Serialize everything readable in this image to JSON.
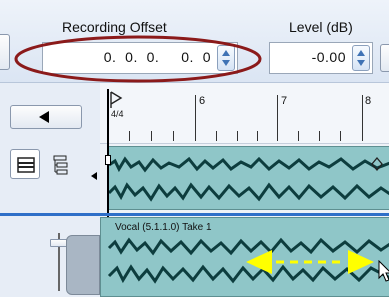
{
  "toolbar": {
    "recording_offset_label": "Recording Offset",
    "recording_offset_value": "0.  0.  0.     0.  0",
    "level_label": "Level (dB)",
    "level_value": "-0.00"
  },
  "ruler": {
    "time_signature": "4/4",
    "measures": [
      "6",
      "7",
      "8"
    ]
  },
  "clip": {
    "name": "Vocal (5.1.1.0) Take 1"
  },
  "colors": {
    "annotation_ring": "#8b1a1a",
    "clip_fill": "#8fc6c8",
    "waveform": "#0d3d3e",
    "arrow": "#ffff00",
    "selection_line": "#2f6fc8"
  },
  "icons": {
    "back_button": "left-arrow-icon",
    "track_view_1": "lanes-icon",
    "track_view_2": "hierarchy-icon",
    "timeline_marker": "flag-icon"
  }
}
